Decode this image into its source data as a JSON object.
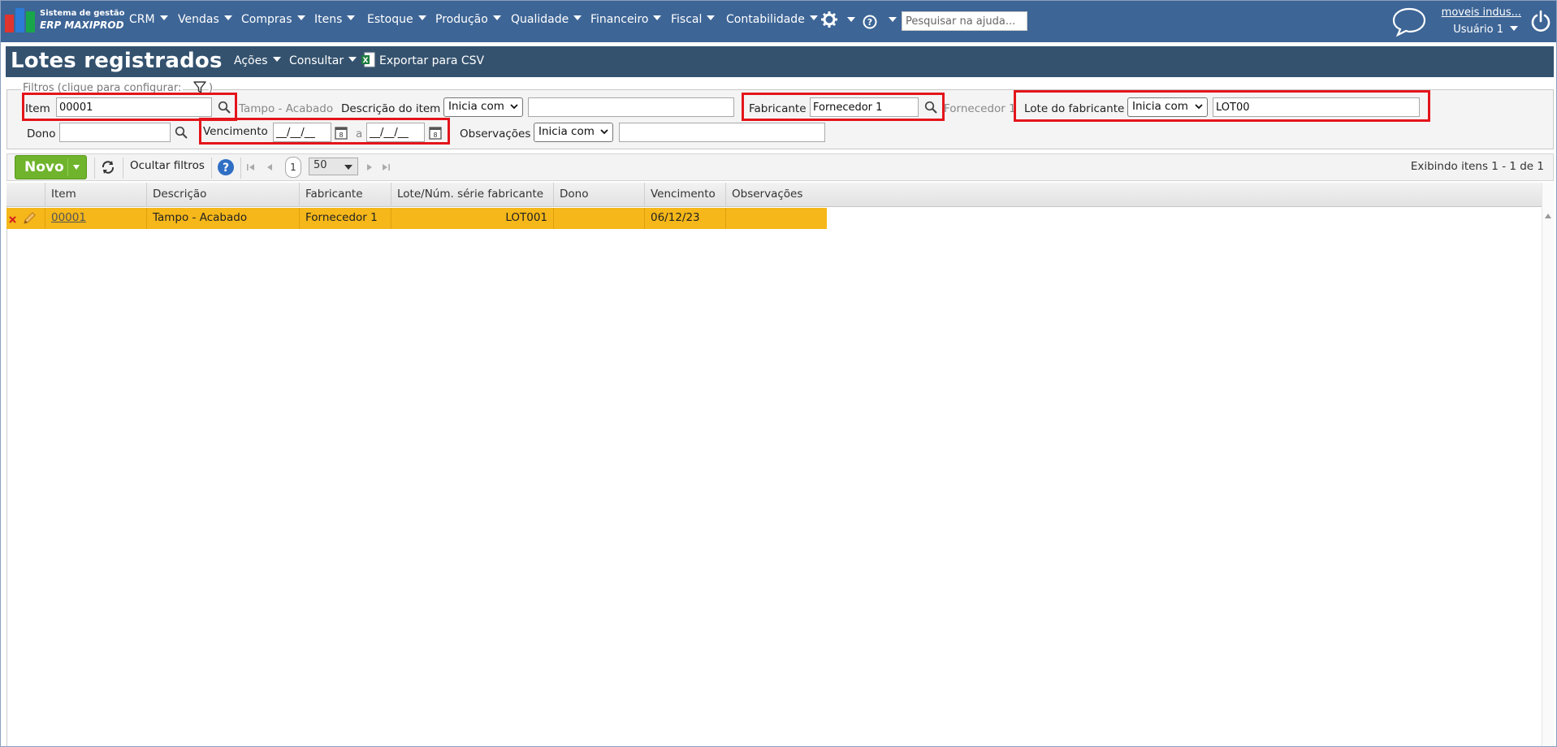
{
  "app": {
    "logo_line1": "Sistema de gestão",
    "logo_line2": "ERP MAXIPROD",
    "menu": [
      "CRM",
      "Vendas",
      "Compras",
      "Itens",
      "Estoque",
      "Produção",
      "Qualidade",
      "Financeiro",
      "Fiscal",
      "Contabilidade"
    ],
    "help_search_placeholder": "Pesquisar na ajuda...",
    "company": "moveis indus...",
    "user": "Usuário 1"
  },
  "page": {
    "title": "Lotes registrados",
    "actions": [
      "Ações",
      "Consultar"
    ],
    "export_label": "Exportar para CSV"
  },
  "filters": {
    "legend": "Filtros (clique para configurar:",
    "legend_close": ")",
    "item_label": "Item",
    "item_value": "00001",
    "item_description": "Tampo - Acabado",
    "desc_label": "Descrição do item",
    "desc_operator": "Inicia com",
    "desc_value": "",
    "fabricante_label": "Fabricante",
    "fabricante_value": "Fornecedor 1",
    "fabricante_description": "Fornecedor 1",
    "lote_label": "Lote do fabricante",
    "lote_operator": "Inicia com",
    "lote_value": "LOT00",
    "dono_label": "Dono",
    "dono_value": "",
    "venc_label": "Vencimento",
    "venc_from": "__/__/__",
    "venc_sep": "a",
    "venc_to": "__/__/__",
    "obs_label": "Observações",
    "obs_operator": "Inicia com",
    "obs_value": ""
  },
  "toolbar": {
    "new_label": "Novo",
    "hide_filters": "Ocultar filtros",
    "page": "1",
    "page_size": "50",
    "showing": "Exibindo itens 1 - 1 de 1"
  },
  "grid": {
    "columns": [
      "Item",
      "Descrição",
      "Fabricante",
      "Lote/Núm. série fabricante",
      "Dono",
      "Vencimento",
      "Observações"
    ],
    "rows": [
      {
        "item": "00001",
        "descricao": "Tampo - Acabado",
        "fabricante": "Fornecedor 1",
        "lote": "LOT001",
        "dono": "",
        "vencimento": "06/12/23",
        "observacoes": ""
      }
    ]
  },
  "colors": {
    "nav_bg": "#3d6596",
    "header_bg": "#34526e",
    "selected_row": "#f5b719",
    "highlight_border": "#e4141b",
    "new_button": "#6fb42c"
  }
}
